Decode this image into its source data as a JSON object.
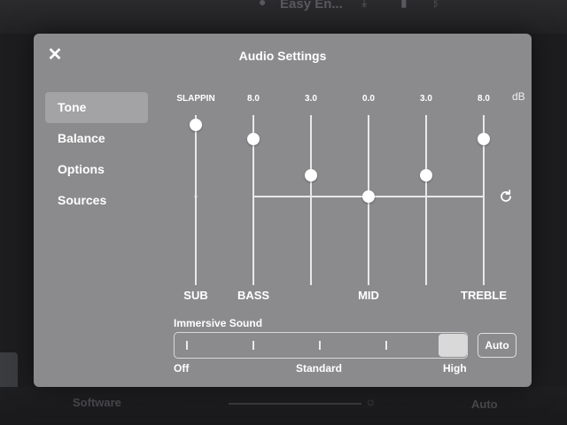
{
  "background": {
    "title": "Easy En...",
    "software_label": "Software",
    "auto_label": "Auto"
  },
  "dialog": {
    "title": "Audio Settings",
    "nav": [
      {
        "label": "Tone",
        "active": true
      },
      {
        "label": "Balance",
        "active": false
      },
      {
        "label": "Options",
        "active": false
      },
      {
        "label": "Sources",
        "active": false
      }
    ]
  },
  "equalizer": {
    "unit": "dB",
    "channels": [
      {
        "label": "SUB",
        "display": "SLAPPIN",
        "value": 10
      },
      {
        "label": "BASS",
        "display": "8.0",
        "value": 8.0
      },
      {
        "label": "",
        "display": "3.0",
        "value": 3.0
      },
      {
        "label": "MID",
        "display": "0.0",
        "value": 0.0
      },
      {
        "label": "",
        "display": "3.0",
        "value": 3.0
      },
      {
        "label": "TREBLE",
        "display": "8.0",
        "value": 8.0
      }
    ]
  },
  "immersive": {
    "title": "Immersive Sound",
    "labels": {
      "off": "Off",
      "standard": "Standard",
      "high": "High"
    },
    "level_fraction": 1.0,
    "auto_label": "Auto"
  },
  "colors": {
    "panel": "#8b8b8d",
    "active_nav": "#a3a3a6",
    "track": "#e8e8e8"
  }
}
